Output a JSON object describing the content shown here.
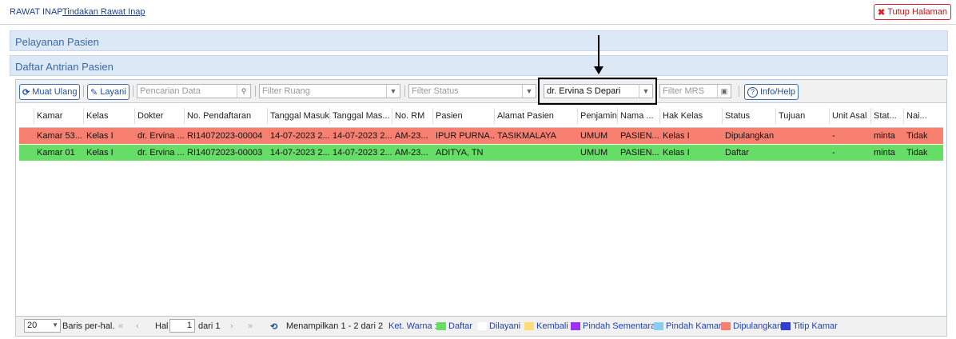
{
  "breadcrumb": {
    "module": "RAWAT INAP",
    "page": "Tindakan Rawat Inap"
  },
  "close_button": "Tutup Halaman",
  "panels": {
    "service": "Pelayanan Pasien",
    "queue": "Daftar Antrian Pasien"
  },
  "toolbar": {
    "reload": "Muat Ulang",
    "serve": "Layani",
    "search_placeholder": "Pencarian Data",
    "room_filter": "Filter Ruang",
    "status_filter": "Filter Status",
    "doctor_filter_value": "dr. Ervina S Depari",
    "mrs_filter": "Filter MRS",
    "info": "Info/Help"
  },
  "columns": [
    "Kamar",
    "Kelas",
    "Dokter",
    "No. Pendaftaran",
    "Tanggal Masuk",
    "Tanggal Mas...",
    "No. RM",
    "Pasien",
    "Alamat Pasien",
    "Penjamin",
    "Nama ...",
    "Hak Kelas",
    "Status",
    "Tujuan",
    "Unit Asal",
    "Stat...",
    "Nai..."
  ],
  "rows": [
    {
      "status_color": "#f88070",
      "cells": [
        "Kamar 53...",
        "Kelas I",
        "dr. Ervina ...",
        "RI14072023-00004",
        "14-07-2023 2...",
        "14-07-2023 2...",
        "AM-23...",
        "IPUR PURNA...",
        "TASIKMALAYA",
        "UMUM",
        "PASIEN...",
        "Kelas I",
        "Dipulangkan",
        "",
        "-",
        "minta",
        "Tidak"
      ]
    },
    {
      "status_color": "#66dd66",
      "cells": [
        "Kamar 01",
        "Kelas I",
        "dr. Ervina ...",
        "RI14072023-00003",
        "14-07-2023 2...",
        "14-07-2023 2...",
        "AM-23...",
        "ADITYA, TN",
        "",
        "UMUM",
        "PASIEN...",
        "Kelas I",
        "Daftar",
        "",
        "-",
        "minta",
        "Tidak"
      ]
    }
  ],
  "pager": {
    "per_page": "20",
    "per_page_label": "Baris per-hal.",
    "page_label": "Hal",
    "page": "1",
    "of_label": "dari 1",
    "display_text": "Menampilkan 1 - 2 dari 2",
    "legend_title": "Ket. Warna :"
  },
  "legend": [
    {
      "label": "Daftar",
      "color": "#66dd66"
    },
    {
      "label": "Dilayani",
      "color": "#ffffff"
    },
    {
      "label": "Kembali",
      "color": "#ffdd77"
    },
    {
      "label": "Pindah Sementara",
      "color": "#9b30ff"
    },
    {
      "label": "Pindah Kamar",
      "color": "#87cef0"
    },
    {
      "label": "Dipulangkan",
      "color": "#f88070"
    },
    {
      "label": "Titip Kamar",
      "color": "#2f3fd0"
    }
  ],
  "icons": [
    "refresh-icon",
    "serve-icon",
    "search-icon",
    "dropdown-icon",
    "calendar-icon",
    "help-icon",
    "close-icon",
    "first-page-icon",
    "prev-page-icon",
    "next-page-icon",
    "last-page-icon",
    "reload-icon"
  ]
}
